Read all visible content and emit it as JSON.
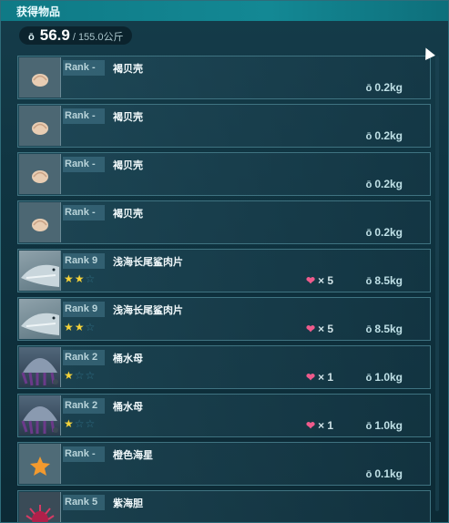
{
  "title": "获得物品",
  "weight": {
    "icon": "weight-icon",
    "current": "56.9",
    "max": "/ 155.0公斤"
  },
  "items": [
    {
      "rank": "Rank -",
      "name": "褐贝壳",
      "weight": "0.2kg",
      "stars": 0,
      "hearts": null,
      "thumb": "shell"
    },
    {
      "rank": "Rank -",
      "name": "褐贝壳",
      "weight": "0.2kg",
      "stars": 0,
      "hearts": null,
      "thumb": "shell"
    },
    {
      "rank": "Rank -",
      "name": "褐贝壳",
      "weight": "0.2kg",
      "stars": 0,
      "hearts": null,
      "thumb": "shell"
    },
    {
      "rank": "Rank -",
      "name": "褐贝壳",
      "weight": "0.2kg",
      "stars": 0,
      "hearts": null,
      "thumb": "shell"
    },
    {
      "rank": "Rank 9",
      "name": "浅海长尾鲨肉片",
      "weight": "8.5kg",
      "stars": 2,
      "hearts": "× 5",
      "thumb": "shark"
    },
    {
      "rank": "Rank 9",
      "name": "浅海长尾鲨肉片",
      "weight": "8.5kg",
      "stars": 2,
      "hearts": "× 5",
      "thumb": "shark"
    },
    {
      "rank": "Rank 2",
      "name": "桶水母",
      "weight": "1.0kg",
      "stars": 1,
      "hearts": "× 1",
      "thumb": "jelly"
    },
    {
      "rank": "Rank 2",
      "name": "桶水母",
      "weight": "1.0kg",
      "stars": 1,
      "hearts": "× 1",
      "thumb": "jelly"
    },
    {
      "rank": "Rank -",
      "name": "橙色海星",
      "weight": "0.1kg",
      "stars": 0,
      "hearts": null,
      "thumb": "star"
    },
    {
      "rank": "Rank 5",
      "name": "紫海胆",
      "weight": "",
      "stars": 0,
      "hearts": null,
      "thumb": "urchin"
    }
  ],
  "colors": {
    "star_on": "#f5d33a",
    "star_off": "#2f6f86",
    "heart": "#ef5b8c"
  }
}
